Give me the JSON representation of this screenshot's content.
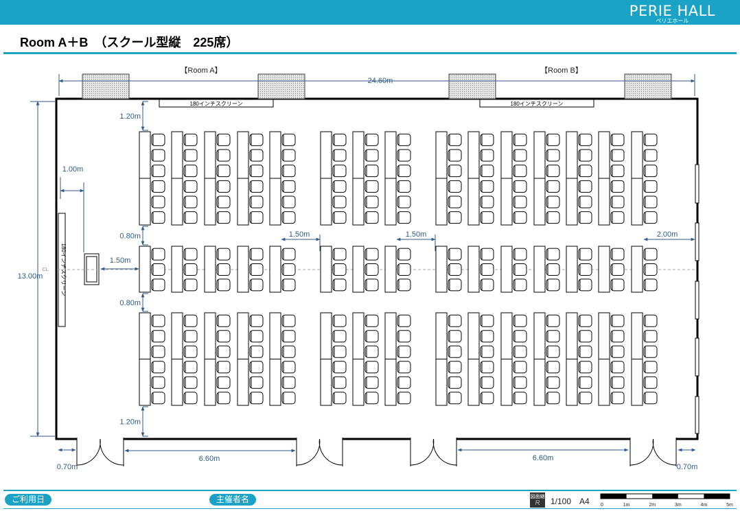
{
  "header": {
    "brand": "PERIE HALL",
    "brand_kana": "ペリエホール"
  },
  "title": "Room A＋B　（スクール型縦　225席）",
  "rooms": {
    "a": "【Room A】",
    "b": "【Room B】"
  },
  "screen_label": "180インチスクリーン",
  "dims": {
    "total_width": "24.60m",
    "height": "13.00m",
    "top_gap": "1.20m",
    "bottom_gap": "1.20m",
    "aisle_h1": "0.80m",
    "aisle_h2": "0.80m",
    "podium_gap": "1.00m",
    "podium_to_desk": "1.50m",
    "block_gap_1": "1.50m",
    "block_gap_2": "1.50m",
    "right_gap": "2.00m",
    "door_left": "0.70m",
    "door_right": "0.70m",
    "wall_left": "6.60m",
    "wall_right": "6.60m",
    "cl": "CL"
  },
  "footer": {
    "date_label": "ご利用日",
    "organizer_label": "主催者名",
    "scale_badge": "図面縮尺",
    "scale": "1/100　A4",
    "scale_ticks": [
      "0",
      "1m",
      "2m",
      "3m",
      "4m",
      "5m"
    ]
  },
  "colors": {
    "accent": "#1aa3c7",
    "dimension": "#2f5a8a"
  }
}
